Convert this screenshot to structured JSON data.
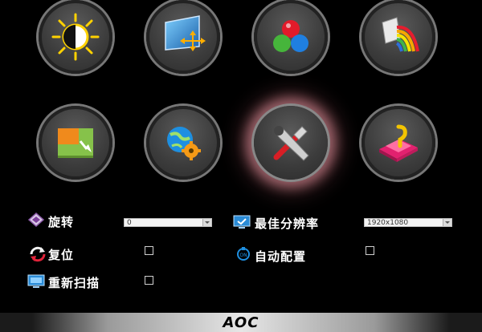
{
  "menu_tiles": [
    {
      "name": "brightness",
      "icon": "brightness-contrast-icon"
    },
    {
      "name": "image-setup",
      "icon": "image-setup-icon"
    },
    {
      "name": "color-setup",
      "icon": "color-setup-icon"
    },
    {
      "name": "color-boost",
      "icon": "color-boost-icon"
    },
    {
      "name": "picture-boost",
      "icon": "picture-boost-icon"
    },
    {
      "name": "osd-setup",
      "icon": "osd-setup-icon"
    },
    {
      "name": "extra",
      "icon": "tools-icon",
      "selected": true
    },
    {
      "name": "exit",
      "icon": "exit-icon"
    }
  ],
  "options": {
    "rotate": {
      "label": "旋转",
      "value": "0"
    },
    "best_resolution": {
      "label": "最佳分辨率",
      "value": "1920x1080"
    },
    "reset": {
      "label": "复位"
    },
    "auto_config": {
      "label": "自动配置"
    },
    "rescan": {
      "label": "重新扫描"
    }
  },
  "footer": {
    "logo": "AOC"
  },
  "colors": {
    "background": "#000000",
    "highlight_glow": "#e696a0"
  }
}
